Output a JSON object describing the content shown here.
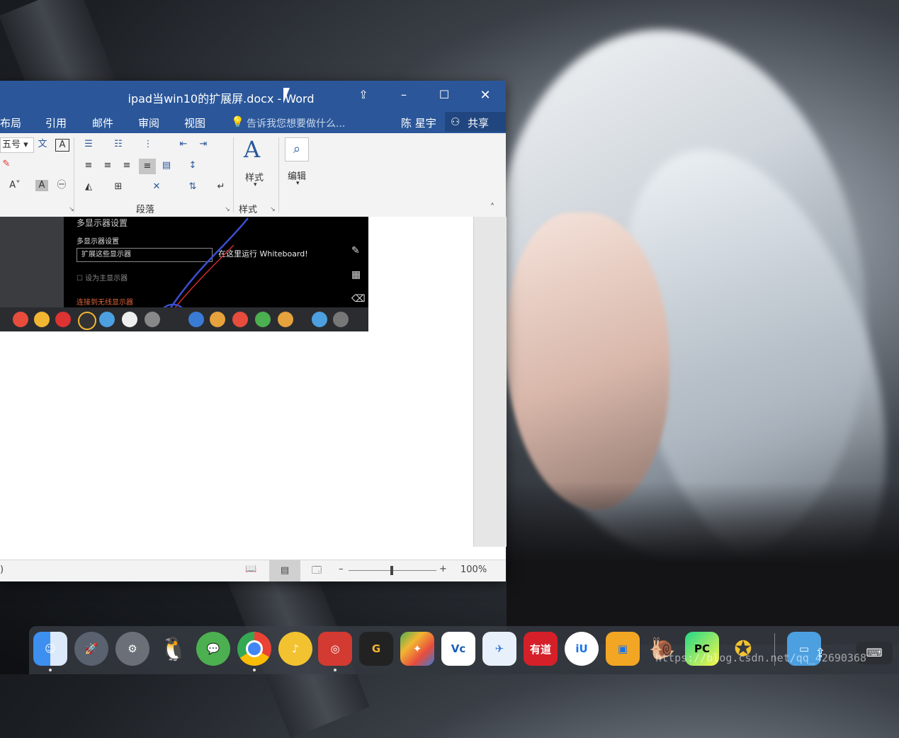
{
  "word": {
    "title": "ipad当win10的扩展屏.docx - Word",
    "tabs": [
      "布局",
      "引用",
      "邮件",
      "审阅",
      "视图"
    ],
    "tell_me": "告诉我您想要做什么...",
    "user": "陈 星宇",
    "share": "共享",
    "font_size": "五号",
    "ribbon": {
      "paragraph_group": "段落",
      "styles_group": "样式",
      "styles_button": "样式",
      "edit_button": "编辑"
    },
    "embedded": {
      "heading": "多显示器设置",
      "sub": "多显示器设置",
      "dropdown": "扩展这些显示器",
      "checkbox": "设为主显示器",
      "wireless": "连接到无线显示器",
      "whiteboard": "在这里运行 Whiteboard!"
    },
    "status": {
      "left": ")",
      "zoom": "100%"
    }
  },
  "dock": {
    "apps": [
      "finder-icon",
      "launchpad-icon",
      "system-preferences-icon",
      "qq-icon",
      "wechat-icon",
      "chrome-icon",
      "qq-music-icon",
      "netease-music-icon",
      "gitlab-icon",
      "mindmaster-icon",
      "vnc-icon",
      "vnote-icon",
      "youdao-icon",
      "iu-icon",
      "window-icon",
      "snail-icon",
      "pycharm-icon",
      "sticky-icon"
    ],
    "youdao_label": "有道",
    "pc_label": "PC",
    "vnc_label": "Vc",
    "iu_label": "iU"
  },
  "watermark": "https://blog.csdn.net/qq_42690368"
}
